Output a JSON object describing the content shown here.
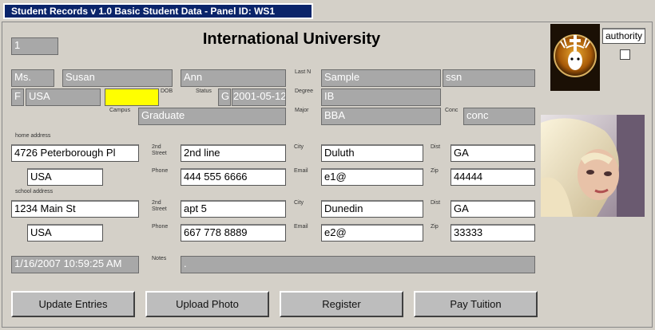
{
  "window": {
    "title": "Student Records v 1.0 Basic Student Data - Panel ID: WS1"
  },
  "header": {
    "university": "International University",
    "record_no": "1"
  },
  "authority": {
    "label": "authority"
  },
  "person": {
    "title": "Ms.",
    "first_name": "Susan",
    "middle_name": "Ann",
    "last_name": "Sample",
    "ssn": "ssn",
    "gender": "F",
    "country": "USA",
    "dob": "",
    "status": "G",
    "date": "2001-05-12",
    "degree": "IB",
    "campus": "Graduate",
    "major": "BBA",
    "conc": "conc"
  },
  "labels": {
    "last_n": "Last N",
    "dob": "DOB",
    "status": "Status",
    "degree": "Degree",
    "campus": "Campus",
    "major": "Major",
    "conc": "Conc",
    "home_address": "home address",
    "second_street": "2nd Street",
    "city": "City",
    "dist": "Dist",
    "phone": "Phone",
    "email": "Email",
    "zip": "Zip",
    "school_address": "school address",
    "notes": "Notes"
  },
  "home": {
    "street": "4726 Peterborough Pl",
    "street2": "2nd line",
    "city": "Duluth",
    "dist": "GA",
    "country": "USA",
    "phone": "444 555 6666",
    "email": "e1@",
    "zip": "44444"
  },
  "school": {
    "street": "1234 Main St",
    "street2": "apt 5",
    "city": "Dunedin",
    "dist": "GA",
    "country": "USA",
    "phone": "667 778 8889",
    "email": "e2@",
    "zip": "33333"
  },
  "footer": {
    "timestamp": "1/16/2007 10:59:25 AM",
    "notes": "."
  },
  "buttons": {
    "update": "Update Entries",
    "upload": "Upload Photo",
    "register": "Register",
    "pay": "Pay Tuition"
  },
  "colors": {
    "titlebar": "#0a246a",
    "readonly_field": "#a8a8a8",
    "dob_field": "#ffff00",
    "background": "#d4d0c8"
  }
}
